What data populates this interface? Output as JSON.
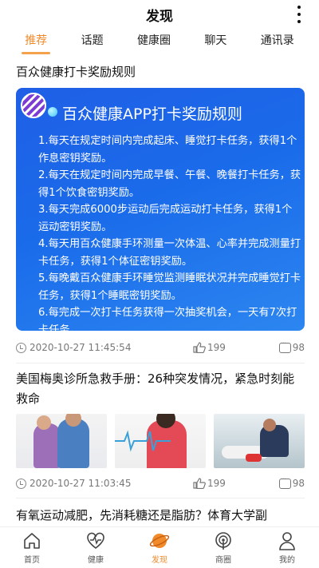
{
  "header": {
    "title": "发现"
  },
  "tabs": [
    {
      "label": "推荐",
      "active": true
    },
    {
      "label": "话题",
      "active": false
    },
    {
      "label": "健康圈",
      "active": false
    },
    {
      "label": "聊天",
      "active": false
    },
    {
      "label": "通讯录",
      "active": false
    }
  ],
  "posts": [
    {
      "title": "百众健康打卡奖励规则",
      "banner": {
        "title": "百众健康APP打卡奖励规则",
        "rules": [
          "1.每天在规定时间内完成起床、睡觉打卡任务，获得1个作息密钥奖励。",
          "2.每天在规定时间内完成早餐、午餐、晚餐打卡任务，获得1个饮食密钥奖励。",
          "3.每天完成6000步运动后完成运动打卡任务，获得1个运动密钥奖励。",
          "4.每天用百众健康手环测量一次体温、心率并完成测量打卡任务，获得1个体征密钥奖励。",
          "5.每晚戴百众健康手环睡觉监测睡眠状况并完成睡觉打卡任务，获得1个睡眠密钥奖励。",
          "6.每完成一次打卡任务获得一次抽奖机会，一天有7次打卡任务。"
        ]
      },
      "time": "2020-10-27 11:45:54",
      "likes": "199",
      "comments": "98"
    },
    {
      "title": "美国梅奥诊所急救手册：26种突发情况，紧急时刻能救命",
      "time": "2020-10-27 11:03:45",
      "likes": "199",
      "comments": "98"
    },
    {
      "title": "有氧运动减肥，先消耗糖还是脂肪？体育大学副"
    }
  ],
  "colors": {
    "accent": "#f08a2a",
    "banner": "#1f64e8"
  },
  "bottom_nav": [
    {
      "label": "首页",
      "icon": "home-icon",
      "active": false
    },
    {
      "label": "健康",
      "icon": "heart-pulse-icon",
      "active": false
    },
    {
      "label": "发现",
      "icon": "planet-icon",
      "active": true
    },
    {
      "label": "商圈",
      "icon": "broadcast-icon",
      "active": false
    },
    {
      "label": "我的",
      "icon": "person-icon",
      "active": false
    }
  ]
}
